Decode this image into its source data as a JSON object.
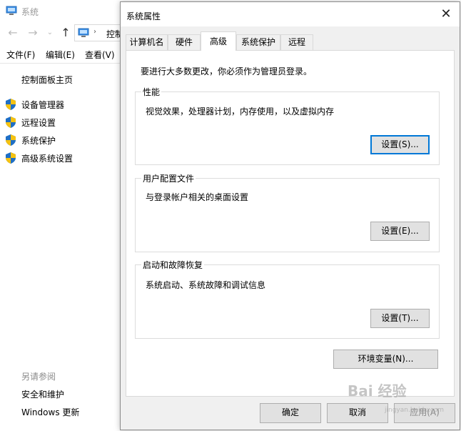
{
  "background_window": {
    "title": "系统",
    "address_text": "控制",
    "menu": [
      "文件(F)",
      "编辑(E)",
      "查看(V)"
    ],
    "home_link": "控制面板主页",
    "links": [
      "设备管理器",
      "远程设置",
      "系统保护",
      "高级系统设置"
    ],
    "see_also_title": "另请参阅",
    "see_also": [
      "安全和维护",
      "Windows 更新"
    ]
  },
  "dialog": {
    "title": "系统属性",
    "close_symbol": "✕",
    "tabs": [
      "计算机名",
      "硬件",
      "高级",
      "系统保护",
      "远程"
    ],
    "active_tab": "高级",
    "intro": "要进行大多数更改，你必须作为管理员登录。",
    "groups": {
      "performance": {
        "title": "性能",
        "description": "视觉效果，处理器计划，内存使用，以及虚拟内存",
        "button": "设置(S)..."
      },
      "profiles": {
        "title": "用户配置文件",
        "description": "与登录帐户相关的桌面设置",
        "button": "设置(E)..."
      },
      "startup": {
        "title": "启动和故障恢复",
        "description": "系统启动、系统故障和调试信息",
        "button": "设置(T)..."
      }
    },
    "env_button": "环境变量(N)...",
    "ok_button": "确定",
    "cancel_button": "取消",
    "apply_button": "应用(A)"
  },
  "watermark": {
    "text": "Bai 经验",
    "sub": "jingyan.baidu.com"
  },
  "colors": {
    "accent": "#0078d7",
    "shield_blue": "#1f6fc5",
    "shield_yellow": "#f5c211"
  }
}
